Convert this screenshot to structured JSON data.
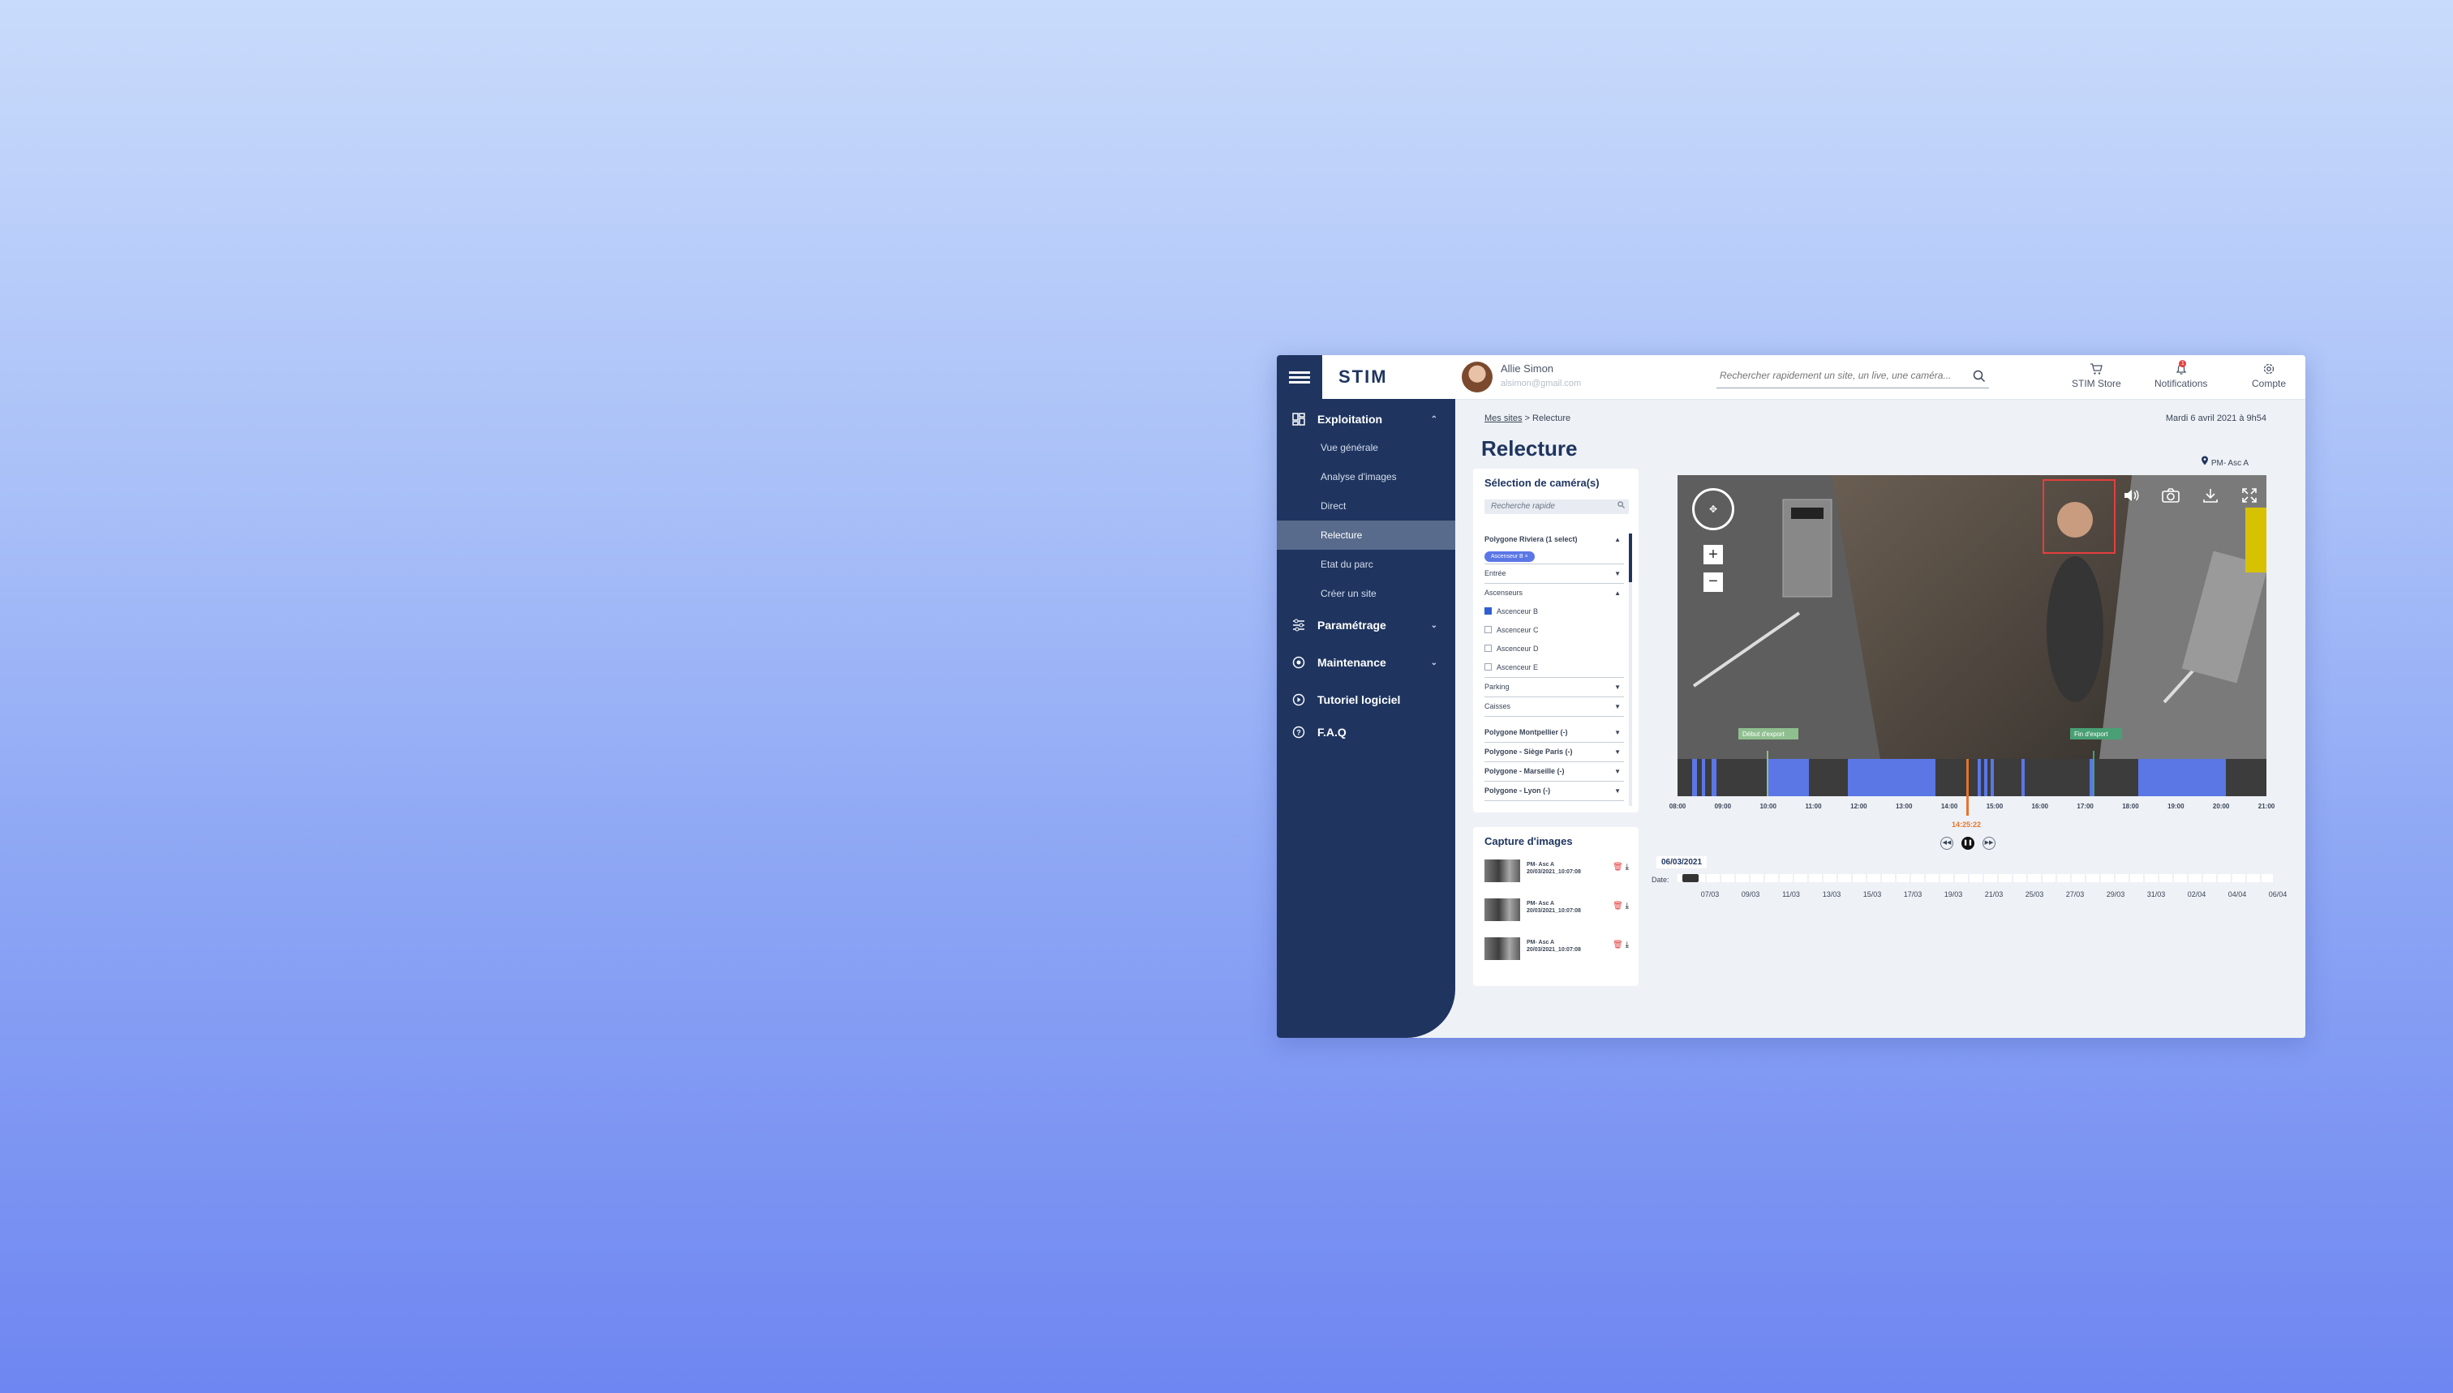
{
  "app": {
    "logo": "STIM"
  },
  "sidebar": {
    "exploitation": "Exploitation",
    "sub": [
      "Vue générale",
      "Analyse d'images",
      "Direct",
      "Relecture",
      "Etat du parc",
      "Créer un site"
    ],
    "parametrage": "Paramétrage",
    "maintenance": "Maintenance",
    "tutoriel": "Tutoriel logiciel",
    "faq": "F.A.Q"
  },
  "header": {
    "user_name": "Allie Simon",
    "user_email": "alsimon@gmail.com",
    "search_placeholder": "Rechercher rapidement un site, un live, une caméra...",
    "store": "STIM Store",
    "notifications": "Notifications",
    "notif_count": "1",
    "account": "Compte"
  },
  "page": {
    "breadcrumb_link": "Mes sites",
    "breadcrumb_sep": " > ",
    "breadcrumb_current": "Relecture",
    "date": "Mardi 6 avril 2021 à 9h54",
    "title": "Relecture",
    "location": "PM- Asc A"
  },
  "camera_selection": {
    "title": "Sélection de caméra(s)",
    "search_placeholder": "Recherche rapide",
    "group1": "Polygone Riviera (1 select)",
    "chip": "Ascenseur B",
    "entree": "Entrée",
    "ascenseurs": "Ascenseurs",
    "items": [
      "Ascenceur B",
      "Ascenceur C",
      "Ascenceur D",
      "Ascenceur E"
    ],
    "parking": "Parking",
    "caisses": "Caisses",
    "groups": [
      "Polygone Montpellier (-)",
      "Polygone - Siège Paris (-)",
      "Polygone - Marseille (-)",
      "Polygone - Lyon (-)"
    ]
  },
  "captures": {
    "title": "Capture d'images",
    "items": [
      {
        "name": "PM- Asc A",
        "date": "20/03/2021_10:07:08"
      },
      {
        "name": "PM- Asc A",
        "date": "20/03/2021_10:07:08"
      },
      {
        "name": "PM- Asc A",
        "date": "20/03/2021_10:07:08"
      }
    ]
  },
  "video": {
    "start_export": "Début d'export",
    "end_export": "Fin d'export",
    "cursor_time": "14:25:22"
  },
  "timeline": {
    "ticks": [
      "08:00",
      "09:00",
      "10:00",
      "11:00",
      "12:00",
      "13:00",
      "14:00",
      "15:00",
      "16:00",
      "17:00",
      "18:00",
      "19:00",
      "20:00",
      "21:00"
    ]
  },
  "dates": {
    "selected": "06/03/2021",
    "label": "Date:",
    "ticks": [
      "07/03",
      "09/03",
      "11/03",
      "13/03",
      "15/03",
      "17/03",
      "19/03",
      "21/03",
      "25/03",
      "27/03",
      "29/03",
      "31/03",
      "02/04",
      "04/04",
      "06/04"
    ]
  },
  "colors": {
    "sidebar": "#1f3560",
    "accent": "#5b77e6",
    "cursor": "#e8732a"
  }
}
